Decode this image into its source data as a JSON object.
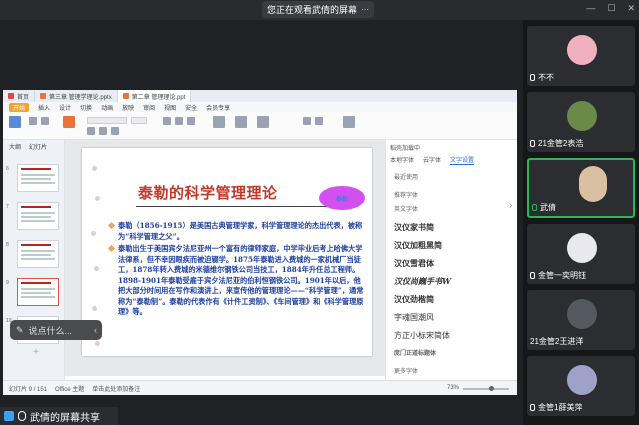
{
  "meeting": {
    "share_notice": "您正在观看武倩的屏幕",
    "share_label": "武倩的屏幕共享"
  },
  "app": {
    "tabs": [
      {
        "label": "首页"
      },
      {
        "label": "第三章 管理学理论.pptx"
      },
      {
        "label": "第二章 管理理论.ppt"
      }
    ],
    "menu": [
      "开始",
      "插入",
      "设计",
      "切换",
      "动画",
      "放映",
      "审阅",
      "视图",
      "安全",
      "会员专享"
    ],
    "thumb_tabs": [
      "大纲",
      "幻灯片"
    ],
    "thumb_numbers": [
      "6",
      "7",
      "8",
      "9",
      "10"
    ],
    "notes_placeholder": "单击此处添加备注",
    "status": {
      "slide_info": "幻灯片 9 / 151",
      "theme": "Office 主题",
      "zoom": "73%"
    }
  },
  "slide": {
    "title": "泰勒的科学管理理论",
    "badge": "泰勒",
    "bullets": [
      "泰勒（1856-1915）是美国古典管理学家，科学管理理论的杰出代表，被称为“科学管理之父”。",
      "泰勒出生于美国宾夕法尼亚州一个富有的律师家庭，中学毕业后考上哈佛大学法律系，但不幸因眼疾而被迫辍学。1875年泰勒进入费城的一家机械厂当徒工，1878年转入费城的米德维尔钢铁公司当技工，1884年升任总工程师。1898-1901年泰勒受雇于宾夕法尼亚的伯利恒钢铁公司。1901年以后，他把大部分时间用在写作和演讲上，来宣传他的管理理论——“科学管理”，通常称为“泰勒制”。泰勒的代表作有《计件工资制》、《车间管理》和《科学管理原理》等。"
    ]
  },
  "right_pane": {
    "head": "稻壳加载中",
    "tabs": [
      "本地字体",
      "云字体",
      "文字设置"
    ],
    "items": [
      "最近使用",
      "推荐字体",
      "英文字体"
    ],
    "font_samples": [
      "汉仪家书简",
      "汉仪加粗黑简",
      "汉仪雪君体",
      "汉仪尚巍手书W",
      "汉仪劲楷简",
      "字魂国潮风",
      "方正小标宋简体",
      "庞门正道标题体"
    ],
    "more": "更多字体"
  },
  "floating": {
    "toast": "说点什么..."
  },
  "participants": [
    {
      "name": "不不",
      "color": "#f0b0c0"
    },
    {
      "name": "21金管2表浩",
      "color": "#6a8a4a"
    },
    {
      "name": "武倩",
      "color": "#d8c0a0",
      "speaking": true
    },
    {
      "name": "金管一奕明钰",
      "color": "#e8e8ee"
    },
    {
      "name": "21金管2王进洋",
      "color": "#555a60"
    },
    {
      "name": "金管1薛美萍",
      "color": "#9fa2c8"
    }
  ]
}
